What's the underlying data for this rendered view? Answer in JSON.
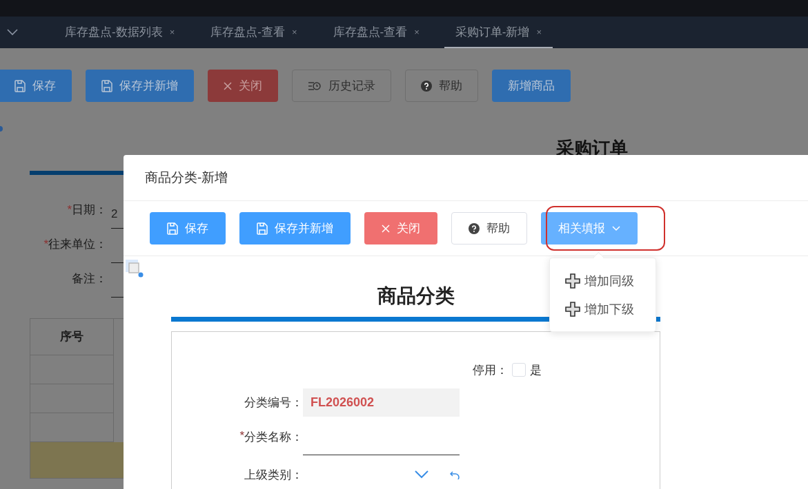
{
  "tabs": [
    {
      "label": "库存盘点-数据列表",
      "close": "×",
      "selected": false
    },
    {
      "label": "库存盘点-查看",
      "close": "×",
      "selected": false
    },
    {
      "label": "库存盘点-查看",
      "close": "×",
      "selected": false
    },
    {
      "label": "采购订单-新增",
      "close": "×",
      "selected": true
    }
  ],
  "toolbar": [
    {
      "label": "保存",
      "kind": "save"
    },
    {
      "label": "保存并新增",
      "kind": "save"
    },
    {
      "label": "关闭",
      "kind": "close"
    },
    {
      "label": "历史记录",
      "kind": "history"
    },
    {
      "label": "帮助",
      "kind": "help"
    },
    {
      "label": "新增商品",
      "kind": "plain"
    }
  ],
  "page": {
    "title": "采购订单",
    "fields": [
      {
        "label": "日期：",
        "required_mark": "*",
        "value": "2"
      },
      {
        "label": "往来单位：",
        "required_mark": "*"
      },
      {
        "label": "备注："
      }
    ],
    "table": {
      "columns": [
        "序号"
      ]
    }
  },
  "dialog": {
    "title": "商品分类-新增",
    "toolbar": [
      {
        "label": "保存",
        "kind": "save"
      },
      {
        "label": "保存并新增",
        "kind": "save"
      },
      {
        "label": "关闭",
        "kind": "close"
      },
      {
        "label": "帮助",
        "kind": "help"
      },
      {
        "label": "相关填报",
        "kind": "dropdown",
        "expanded": true,
        "highlighted": true
      }
    ],
    "menu": [
      {
        "label": "增加同级"
      },
      {
        "label": "增加下级"
      }
    ],
    "heading": "商品分类",
    "disabled_field": {
      "label": "停用：",
      "checked": false,
      "option": "是"
    },
    "fields": [
      {
        "label": "分类编号：",
        "kind": "readonly",
        "value": "FL2026002"
      },
      {
        "label": "分类名称：",
        "required_mark": "*",
        "kind": "text"
      },
      {
        "label": "上级类别：",
        "kind": "picker"
      }
    ]
  }
}
